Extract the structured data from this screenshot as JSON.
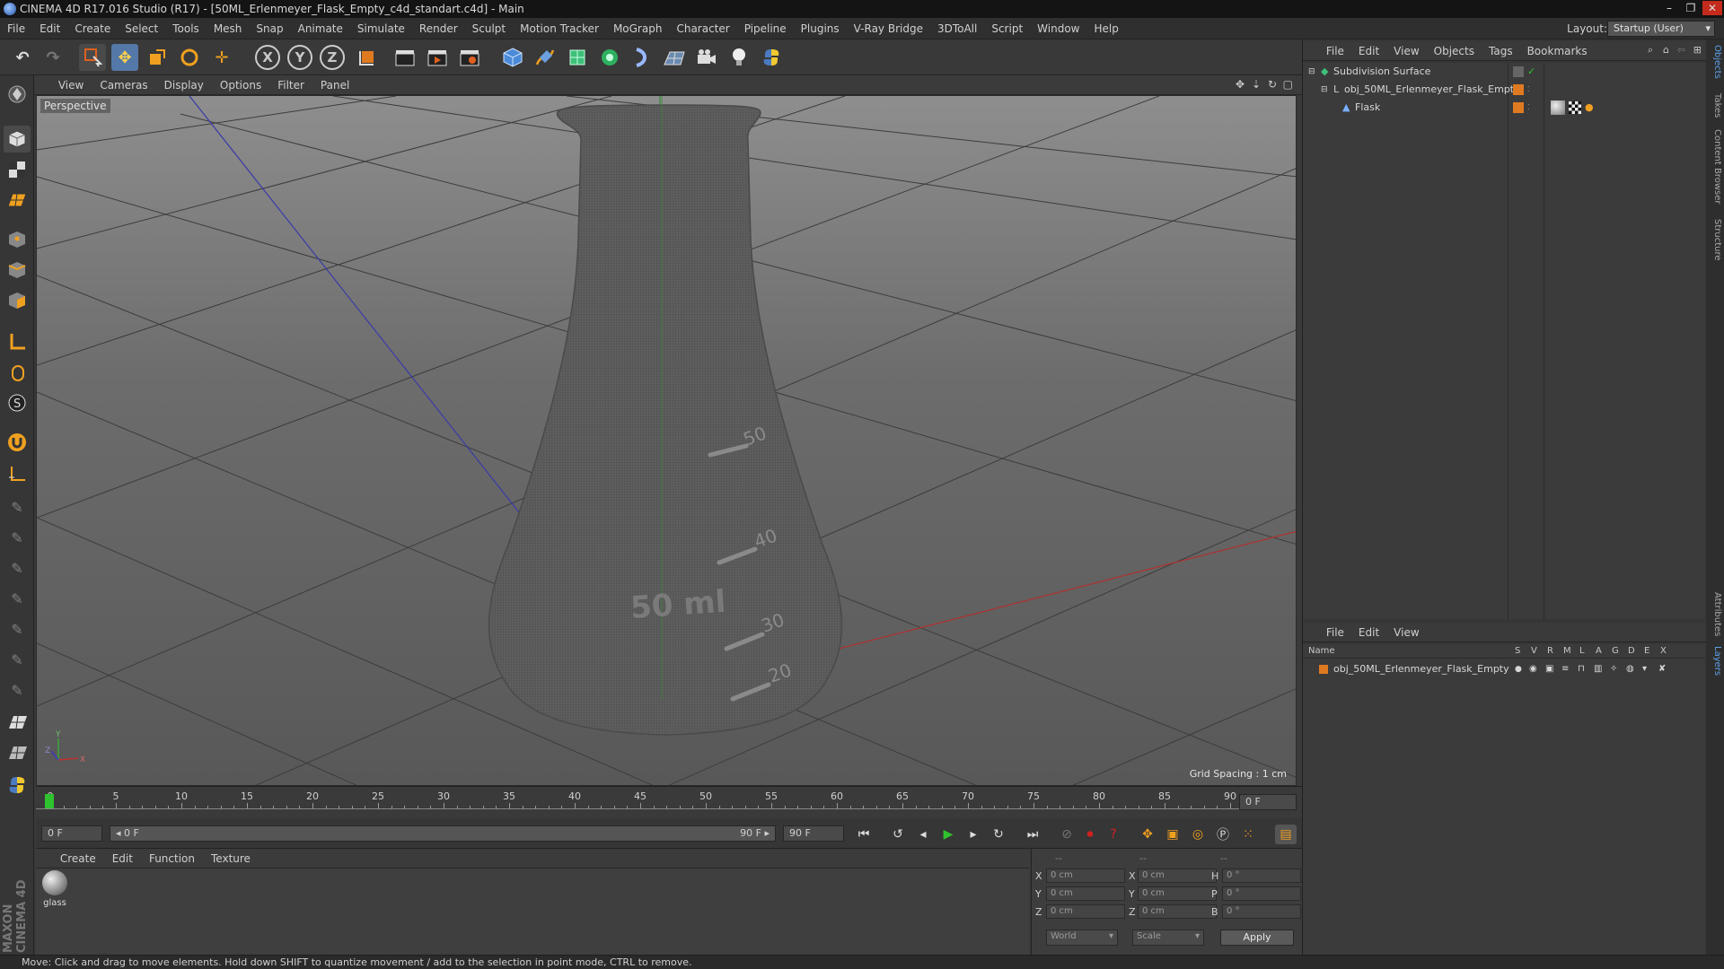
{
  "window": {
    "title": "CINEMA 4D R17.016 Studio (R17) - [50ML_Erlenmeyer_Flask_Empty_c4d_standart.c4d] - Main",
    "controls": [
      "–",
      "❐",
      "✕"
    ]
  },
  "menubar": {
    "items": [
      "File",
      "Edit",
      "Create",
      "Select",
      "Tools",
      "Mesh",
      "Snap",
      "Animate",
      "Simulate",
      "Render",
      "Sculpt",
      "Motion Tracker",
      "MoGraph",
      "Character",
      "Pipeline",
      "Plugins",
      "V-Ray Bridge",
      "3DToAll",
      "Script",
      "Window",
      "Help"
    ],
    "layout_label": "Layout:",
    "layout_value": "Startup (User)"
  },
  "toolbar": {
    "axis_x": "X",
    "axis_y": "Y",
    "axis_z": "Z"
  },
  "viewport": {
    "menu": [
      "View",
      "Cameras",
      "Display",
      "Options",
      "Filter",
      "Panel"
    ],
    "camera_label": "Perspective",
    "grid_spacing": "Grid Spacing : 1 cm",
    "flask_text": "50 ml",
    "marks": [
      "50",
      "40",
      "30",
      "20"
    ],
    "axis_y_label": "Y",
    "axis_x_label": "X",
    "axis_z_label": "Z"
  },
  "timeline": {
    "ticks": [
      "0",
      "5",
      "10",
      "15",
      "20",
      "25",
      "30",
      "35",
      "40",
      "45",
      "50",
      "55",
      "60",
      "65",
      "70",
      "75",
      "80",
      "85",
      "90"
    ],
    "current_frame": "0 F"
  },
  "playbar": {
    "start_field": "0 F",
    "range_start": "◂ 0 F",
    "range_end": "90 F ▸",
    "end_field": "90 F"
  },
  "material_manager": {
    "menu": [
      "Create",
      "Edit",
      "Function",
      "Texture"
    ],
    "materials": [
      {
        "name": "glass"
      }
    ]
  },
  "coordinates": {
    "header": [
      "--",
      "--",
      "--"
    ],
    "rows": [
      {
        "a": "X",
        "av": "0 cm",
        "b": "X",
        "bv": "0 cm",
        "c": "H",
        "cv": "0 °"
      },
      {
        "a": "Y",
        "av": "0 cm",
        "b": "Y",
        "bv": "0 cm",
        "c": "P",
        "cv": "0 °"
      },
      {
        "a": "Z",
        "av": "0 cm",
        "b": "Z",
        "bv": "0 cm",
        "c": "B",
        "cv": "0 °"
      }
    ],
    "mode": "World",
    "size_mode": "Scale",
    "apply": "Apply"
  },
  "object_manager": {
    "menu": [
      "File",
      "Edit",
      "View",
      "Objects",
      "Tags",
      "Bookmarks"
    ],
    "objects": [
      {
        "name": "Subdivision Surface"
      },
      {
        "name": "obj_50ML_Erlenmeyer_Flask_Empty"
      },
      {
        "name": "Flask"
      }
    ]
  },
  "layer_manager": {
    "menu": [
      "File",
      "Edit",
      "View"
    ],
    "columns": [
      "Name",
      "S",
      "V",
      "R",
      "M",
      "L",
      "A",
      "G",
      "D",
      "E",
      "X"
    ],
    "layers": [
      {
        "name": "obj_50ML_Erlenmeyer_Flask_Empty"
      }
    ]
  },
  "side_tabs": [
    "Objects",
    "Takes",
    "Content Browser",
    "Structure",
    "Attributes",
    "Layers"
  ],
  "branding": {
    "line1": "MAXON",
    "line2": "CINEMA 4D"
  },
  "status": "Move: Click and drag to move elements. Hold down SHIFT to quantize movement / add to the selection in point mode, CTRL to remove.",
  "colors": {
    "accent": "#5ea0e8",
    "orange": "#e07a20",
    "play_green": "#2ec32e",
    "record_red": "#d02020"
  }
}
